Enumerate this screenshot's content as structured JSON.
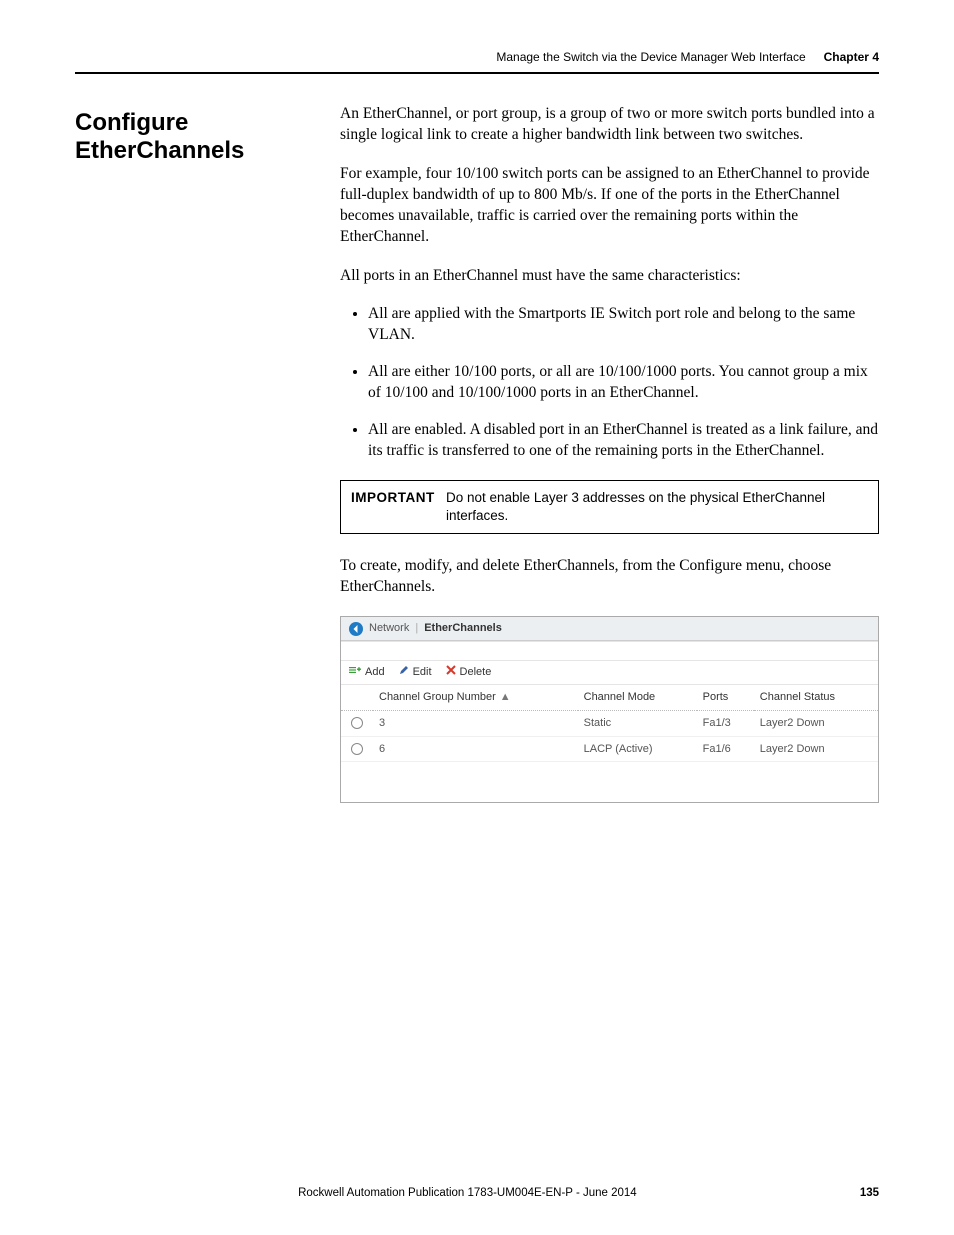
{
  "header": {
    "title": "Manage the Switch via the Device Manager Web Interface",
    "chapter": "Chapter 4"
  },
  "section": {
    "title": "Configure EtherChannels"
  },
  "body": {
    "p1": "An EtherChannel, or port group, is a group of two or more switch ports bundled into a single logical link to create a higher bandwidth link between two switches.",
    "p2": "For example, four 10/100 switch ports can be assigned to an EtherChannel to provide full-duplex bandwidth of up to 800 Mb/s. If one of the ports in the EtherChannel becomes unavailable, traffic is carried over the remaining ports within the EtherChannel.",
    "p3": "All ports in an EtherChannel must have the same characteristics:",
    "bullets": [
      "All are applied with the Smartports IE Switch port role and belong to the same VLAN.",
      "All are either 10/100 ports, or all are 10/100/1000 ports. You cannot group a mix of 10/100 and 10/100/1000 ports in an EtherChannel.",
      "All are enabled. A disabled port in an EtherChannel is treated as a link failure, and its traffic is transferred to one of the remaining ports in the EtherChannel."
    ],
    "important_label": "IMPORTANT",
    "important_text": "Do not enable Layer 3 addresses on the physical EtherChannel interfaces.",
    "p4": "To create, modify, and delete EtherChannels, from the Configure menu, choose EtherChannels."
  },
  "app": {
    "breadcrumb": {
      "item1": "Network",
      "item2": "EtherChannels"
    },
    "toolbar": {
      "add": "Add",
      "edit": "Edit",
      "delete": "Delete"
    },
    "columns": {
      "cgn": "Channel Group Number",
      "mode": "Channel Mode",
      "ports": "Ports",
      "status": "Channel Status"
    },
    "rows": [
      {
        "cgn": "3",
        "mode": "Static",
        "ports": "Fa1/3",
        "status": "Layer2 Down"
      },
      {
        "cgn": "6",
        "mode": "LACP (Active)",
        "ports": "Fa1/6",
        "status": "Layer2 Down"
      }
    ]
  },
  "footer": {
    "publication": "Rockwell Automation Publication 1783-UM004E-EN-P - June 2014",
    "page": "135"
  }
}
